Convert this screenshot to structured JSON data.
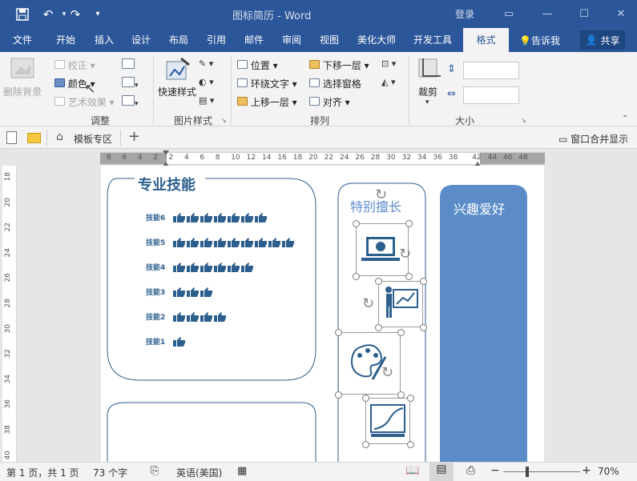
{
  "window": {
    "title": "图标简历 - Word",
    "login_label": "登录",
    "min_icon": "minimize-icon",
    "restore_icon": "restore-icon",
    "close_icon": "close-icon"
  },
  "tabs": [
    {
      "label": "文件"
    },
    {
      "label": "开始"
    },
    {
      "label": "插入"
    },
    {
      "label": "设计"
    },
    {
      "label": "布局"
    },
    {
      "label": "引用"
    },
    {
      "label": "邮件"
    },
    {
      "label": "审阅"
    },
    {
      "label": "视图"
    },
    {
      "label": "美化大师"
    },
    {
      "label": "开发工具"
    },
    {
      "label": "格式"
    }
  ],
  "tell_me": "告诉我",
  "share": "共享",
  "ribbon": {
    "remove_bg": "删除背景",
    "correct": "校正",
    "color": "颜色",
    "art_effect": "艺术效果",
    "group_adjust": "调整",
    "quick_style": "快速样式",
    "group_picture_style": "图片样式",
    "position": "位置",
    "wrap_text": "环绕文字",
    "bring_forward": "上移一层",
    "send_backward": "下移一层",
    "selection_pane": "选择窗格",
    "align": "对齐",
    "group_arrange": "排列",
    "crop": "裁剪",
    "group_size": "大小"
  },
  "subbar": {
    "templates": "模板专区",
    "window_merge": "窗口合并显示"
  },
  "ruler": {
    "h_ticks": [
      "8",
      "6",
      "4",
      "2",
      "2",
      "4",
      "6",
      "8",
      "10",
      "12",
      "14",
      "16",
      "18",
      "20",
      "22",
      "24",
      "26",
      "28",
      "30",
      "32",
      "34",
      "36",
      "38",
      "42",
      "44",
      "46",
      "48"
    ],
    "v_ticks": [
      "18",
      "20",
      "22",
      "24",
      "26",
      "28",
      "30",
      "32",
      "34",
      "36",
      "38",
      "40",
      "42"
    ]
  },
  "document": {
    "skills_title": "专业技能",
    "skills": [
      {
        "label": "技能6",
        "level": 7
      },
      {
        "label": "技能5",
        "level": 9
      },
      {
        "label": "技能4",
        "level": 6
      },
      {
        "label": "技能3",
        "level": 3
      },
      {
        "label": "技能2",
        "level": 4
      },
      {
        "label": "技能1",
        "level": 1
      }
    ],
    "specialty_title": "特别擅长",
    "hobby_title": "兴趣爱好",
    "colors": {
      "accent": "#2d5f8e",
      "hobby_bg": "#5b8cc8",
      "title_bar": "#2b579a"
    }
  },
  "status": {
    "page": "第 1 页，共 1 页",
    "words": "73 个字",
    "language": "英语(美国)",
    "zoom": "70%"
  }
}
